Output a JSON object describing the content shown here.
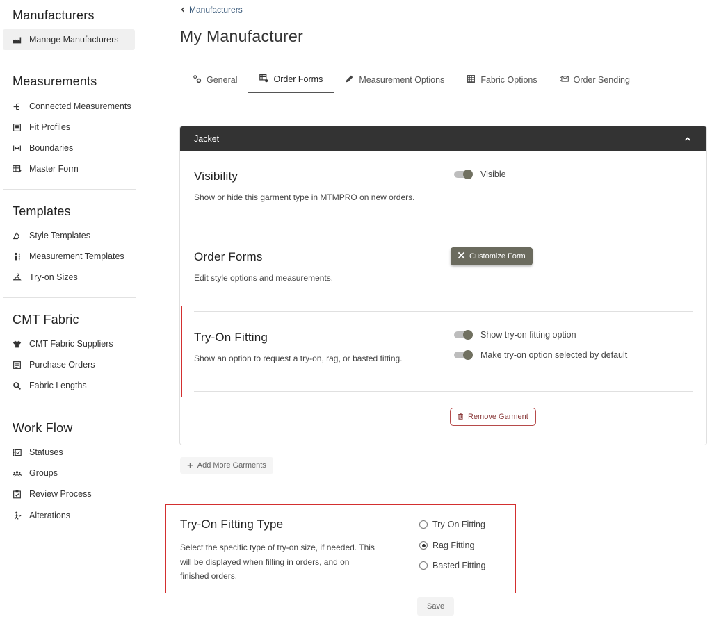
{
  "sidebar": {
    "sections": [
      {
        "title": "Manufacturers",
        "items": [
          {
            "label": "Manage Manufacturers",
            "icon": "factory-icon",
            "active": true
          }
        ]
      },
      {
        "title": "Measurements",
        "items": [
          {
            "label": "Connected Measurements",
            "icon": "hierarchy-icon"
          },
          {
            "label": "Fit Profiles",
            "icon": "profile-book-icon"
          },
          {
            "label": "Boundaries",
            "icon": "boundaries-icon"
          },
          {
            "label": "Master Form",
            "icon": "table-edit-icon"
          }
        ]
      },
      {
        "title": "Templates",
        "items": [
          {
            "label": "Style Templates",
            "icon": "style-icon"
          },
          {
            "label": "Measurement Templates",
            "icon": "person-measure-icon"
          },
          {
            "label": "Try-on Sizes",
            "icon": "hanger-icon"
          }
        ]
      },
      {
        "title": "CMT Fabric",
        "items": [
          {
            "label": "CMT Fabric Suppliers",
            "icon": "shirt-icon"
          },
          {
            "label": "Purchase Orders",
            "icon": "document-list-icon"
          },
          {
            "label": "Fabric Lengths",
            "icon": "search-fabric-icon"
          }
        ]
      },
      {
        "title": "Work Flow",
        "items": [
          {
            "label": "Statuses",
            "icon": "status-flow-icon"
          },
          {
            "label": "Groups",
            "icon": "group-icon"
          },
          {
            "label": "Review Process",
            "icon": "clipboard-check-icon"
          },
          {
            "label": "Alterations",
            "icon": "alterations-icon"
          }
        ]
      }
    ]
  },
  "breadcrumb": {
    "label": "Manufacturers"
  },
  "page": {
    "title": "My Manufacturer"
  },
  "tabs": [
    {
      "label": "General",
      "icon": "gears-icon"
    },
    {
      "label": "Order Forms",
      "icon": "form-settings-icon",
      "active": true
    },
    {
      "label": "Measurement Options",
      "icon": "pencil-icon"
    },
    {
      "label": "Fabric Options",
      "icon": "fabric-grid-icon"
    },
    {
      "label": "Order Sending",
      "icon": "send-mail-icon"
    }
  ],
  "garment": {
    "name": "Jacket",
    "visibility": {
      "title": "Visibility",
      "desc": "Show or hide this garment type in MTMPRO on new orders.",
      "toggle_label": "Visible"
    },
    "order_forms": {
      "title": "Order Forms",
      "desc": "Edit style options and measurements.",
      "button": "Customize Form"
    },
    "tryon": {
      "title": "Try-On Fitting",
      "desc": "Show an option to request a try-on, rag, or basted fitting.",
      "toggle1": "Show try-on fitting option",
      "toggle2": "Make try-on option selected by default"
    },
    "remove_button": "Remove Garment"
  },
  "add_more": "Add More Garments",
  "fitting_type": {
    "title": "Try-On Fitting Type",
    "desc_line1": "Select the specific type of try-on size, if needed. This",
    "desc_line2": "will be displayed when filling in orders, and on",
    "desc_line3": "finished orders.",
    "options": [
      "Try-On Fitting",
      "Rag Fitting",
      "Basted Fitting"
    ],
    "selected": "Rag Fitting"
  },
  "save": "Save",
  "colors": {
    "header": "#333333",
    "highlight": "#d32f2f",
    "button_dark": "#6b6b5e"
  }
}
